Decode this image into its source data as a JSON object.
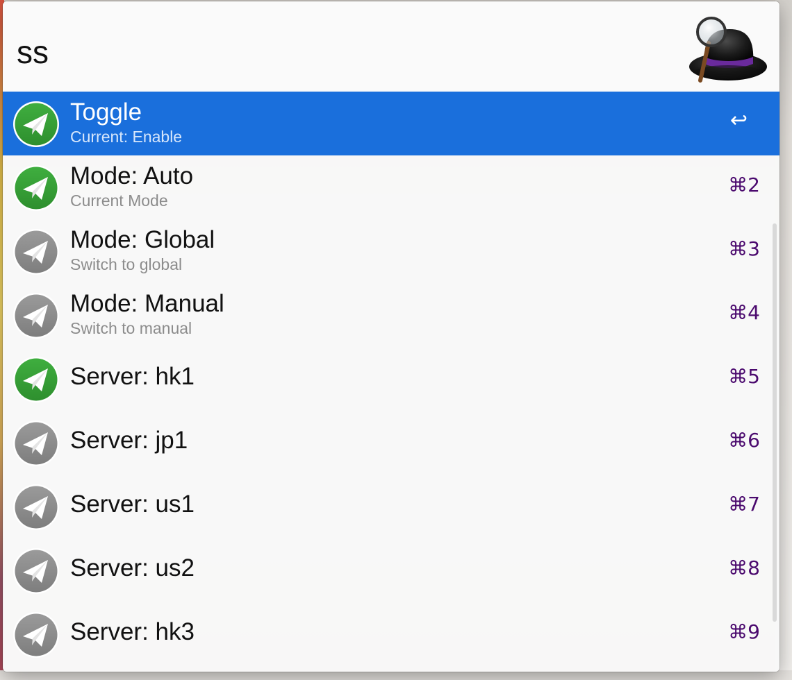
{
  "search": {
    "query": "ss"
  },
  "logo": {
    "icon": "alfred-hat-icon"
  },
  "colors": {
    "selection": "#1a6fdc",
    "shortcut": "#4b0a6e",
    "icon_active": "#3fae3f",
    "icon_inactive": "#9a9a9a"
  },
  "results": [
    {
      "title": "Toggle",
      "subtitle": "Current: Enable",
      "shortcut": "↩",
      "icon": "paper-plane-icon",
      "active": true,
      "selected": true
    },
    {
      "title": "Mode: Auto",
      "subtitle": "Current Mode",
      "shortcut": "⌘2",
      "icon": "paper-plane-icon",
      "active": true,
      "selected": false
    },
    {
      "title": "Mode: Global",
      "subtitle": "Switch to global",
      "shortcut": "⌘3",
      "icon": "paper-plane-icon",
      "active": false,
      "selected": false
    },
    {
      "title": "Mode: Manual",
      "subtitle": "Switch to manual",
      "shortcut": "⌘4",
      "icon": "paper-plane-icon",
      "active": false,
      "selected": false
    },
    {
      "title": "Server: hk1",
      "subtitle": "",
      "shortcut": "⌘5",
      "icon": "paper-plane-icon",
      "active": true,
      "selected": false
    },
    {
      "title": "Server: jp1",
      "subtitle": "",
      "shortcut": "⌘6",
      "icon": "paper-plane-icon",
      "active": false,
      "selected": false
    },
    {
      "title": "Server: us1",
      "subtitle": "",
      "shortcut": "⌘7",
      "icon": "paper-plane-icon",
      "active": false,
      "selected": false
    },
    {
      "title": "Server: us2",
      "subtitle": "",
      "shortcut": "⌘8",
      "icon": "paper-plane-icon",
      "active": false,
      "selected": false
    },
    {
      "title": "Server: hk3",
      "subtitle": "",
      "shortcut": "⌘9",
      "icon": "paper-plane-icon",
      "active": false,
      "selected": false
    }
  ]
}
